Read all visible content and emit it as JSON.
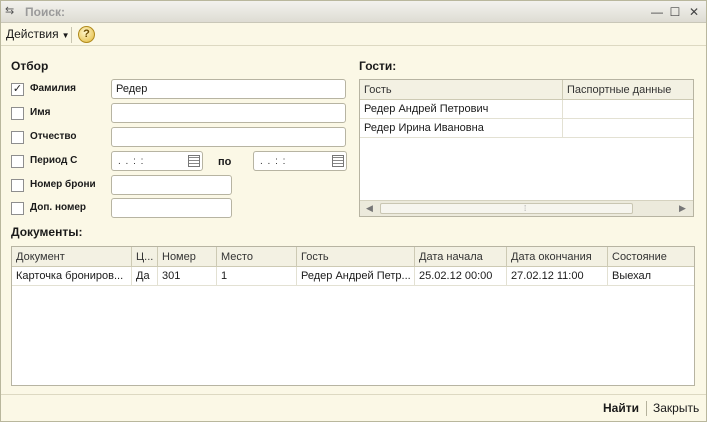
{
  "window": {
    "title": "Поиск:",
    "controls": [
      "—",
      "☐",
      "✕"
    ]
  },
  "toolbar": {
    "actions_label": "Действия",
    "help_label": "?"
  },
  "filter": {
    "title": "Отбор",
    "rows": [
      {
        "label": "Фамилия",
        "checked": true,
        "value": "Редер"
      },
      {
        "label": "Имя",
        "checked": false,
        "value": ""
      },
      {
        "label": "Отчество",
        "checked": false,
        "value": ""
      },
      {
        "label": "Период  С",
        "checked": false,
        "date_from": " .  .      :  : ",
        "date_to": " .  .      :  : "
      },
      {
        "label": "Номер брони",
        "checked": false,
        "value": ""
      },
      {
        "label": "Доп. номер",
        "checked": false,
        "value": ""
      }
    ],
    "period_to_label": "по"
  },
  "guests": {
    "title": "Гости:",
    "columns": [
      "Гость",
      "Паспортные данные"
    ],
    "rows": [
      [
        "Редер Андрей Петрович",
        ""
      ],
      [
        "Редер Ирина Ивановна",
        ""
      ]
    ]
  },
  "documents": {
    "title": "Документы:",
    "columns": [
      "Документ",
      "Ц...",
      "Номер",
      "Место",
      "Гость",
      "Дата начала",
      "Дата окончания",
      "Состояние"
    ],
    "rows": [
      [
        "Карточка брониров...",
        "Да",
        "301",
        "1",
        "Редер Андрей Петр...",
        "25.02.12 00:00",
        "27.02.12 11:00",
        "Выехал"
      ]
    ]
  },
  "footer": {
    "find_label": "Найти",
    "close_label": "Закрыть"
  }
}
